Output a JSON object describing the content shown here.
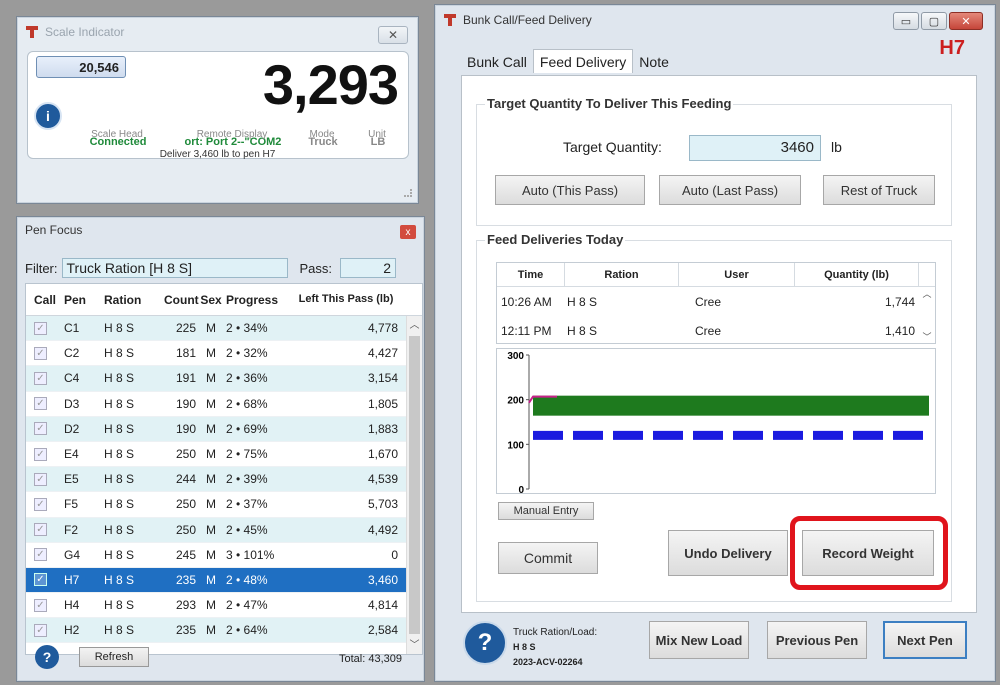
{
  "scale_indicator": {
    "title": "Scale Indicator",
    "close_label": "✕",
    "tare_value": "20,546",
    "weight": "3,293",
    "stats": [
      {
        "value": "Connected",
        "label": "Scale Head",
        "color": "#1f8a3a"
      },
      {
        "value": "ort: Port 2--\"COM2",
        "label": "Remote Display",
        "color": "#1f8a3a"
      },
      {
        "value": "Truck",
        "label": "Mode",
        "color": "#888888"
      },
      {
        "value": "LB",
        "label": "Unit",
        "color": "#888888"
      }
    ],
    "message": "Deliver 3,460 lb to pen H7"
  },
  "pen_focus": {
    "title": "Pen Focus",
    "close_label": "x",
    "filter_label": "Filter:",
    "filter_value": "Truck Ration [H 8 S]",
    "pass_label": "Pass:",
    "pass_value": "2",
    "columns": [
      "Call",
      "Pen",
      "Ration",
      "Count",
      "Sex",
      "Progress",
      "Left This Pass (lb)"
    ],
    "rows": [
      {
        "pen": "C1",
        "ration": "H 8 S",
        "count": "225",
        "sex": "M",
        "progress": "2 • 34%",
        "left": "4,778"
      },
      {
        "pen": "C2",
        "ration": "H 8 S",
        "count": "181",
        "sex": "M",
        "progress": "2 • 32%",
        "left": "4,427"
      },
      {
        "pen": "C4",
        "ration": "H 8 S",
        "count": "191",
        "sex": "M",
        "progress": "2 • 36%",
        "left": "3,154"
      },
      {
        "pen": "D3",
        "ration": "H 8 S",
        "count": "190",
        "sex": "M",
        "progress": "2 • 68%",
        "left": "1,805"
      },
      {
        "pen": "D2",
        "ration": "H 8 S",
        "count": "190",
        "sex": "M",
        "progress": "2 • 69%",
        "left": "1,883"
      },
      {
        "pen": "E4",
        "ration": "H 8 S",
        "count": "250",
        "sex": "M",
        "progress": "2 • 75%",
        "left": "1,670"
      },
      {
        "pen": "E5",
        "ration": "H 8 S",
        "count": "244",
        "sex": "M",
        "progress": "2 • 39%",
        "left": "4,539"
      },
      {
        "pen": "F5",
        "ration": "H 8 S",
        "count": "250",
        "sex": "M",
        "progress": "2 • 37%",
        "left": "5,703"
      },
      {
        "pen": "F2",
        "ration": "H 8 S",
        "count": "250",
        "sex": "M",
        "progress": "2 • 45%",
        "left": "4,492"
      },
      {
        "pen": "G4",
        "ration": "H 8 S",
        "count": "245",
        "sex": "M",
        "progress": "3 • 101%",
        "left": "0"
      },
      {
        "pen": "H7",
        "ration": "H 8 S",
        "count": "235",
        "sex": "M",
        "progress": "2 • 48%",
        "left": "3,460",
        "selected": true
      },
      {
        "pen": "H4",
        "ration": "H 8 S",
        "count": "293",
        "sex": "M",
        "progress": "2 • 47%",
        "left": "4,814"
      },
      {
        "pen": "H2",
        "ration": "H 8 S",
        "count": "235",
        "sex": "M",
        "progress": "2 • 64%",
        "left": "2,584"
      }
    ],
    "refresh_label": "Refresh",
    "total": "Total: 43,309"
  },
  "feed_window": {
    "title": "Bunk Call/Feed Delivery",
    "pen_code": "H7",
    "tabs": [
      "Bunk Call",
      "Feed Delivery",
      "Note"
    ],
    "target_group_title": "Target Quantity To Deliver This Feeding",
    "target_label": "Target Quantity:",
    "target_value": "3460",
    "target_unit": "lb",
    "auto_this_pass": "Auto (This Pass)",
    "auto_last_pass": "Auto (Last Pass)",
    "rest_of_truck": "Rest of Truck",
    "deliveries_group_title": "Feed Deliveries Today",
    "delivery_columns": [
      "Time",
      "Ration",
      "User",
      "Quantity (lb)"
    ],
    "deliveries": [
      {
        "time": "10:26 AM",
        "ration": "H 8 S",
        "user": "Cree",
        "qty": "1,744"
      },
      {
        "time": "12:11 PM",
        "ration": "H 8 S",
        "user": "Cree",
        "qty": "1,410"
      }
    ],
    "manual_entry": "Manual Entry",
    "commit": "Commit",
    "undo_delivery": "Undo Delivery",
    "record_weight": "Record Weight",
    "load_label": "Truck Ration/Load:",
    "load_ration": "H 8 S",
    "load_id": "2023-ACV-02264",
    "mix_new_load": "Mix New Load",
    "previous_pen": "Previous Pen",
    "next_pen": "Next Pen",
    "highlight_color": "#e0141c"
  },
  "chart_data": {
    "type": "bar",
    "yticks": [
      "300",
      "200",
      "100",
      "0"
    ],
    "ylim": [
      0,
      300
    ],
    "series": [
      {
        "values": [
          200
        ],
        "color": "#1e7a1e"
      },
      {
        "values": [
          120
        ],
        "color": "#1a1adf"
      }
    ]
  }
}
